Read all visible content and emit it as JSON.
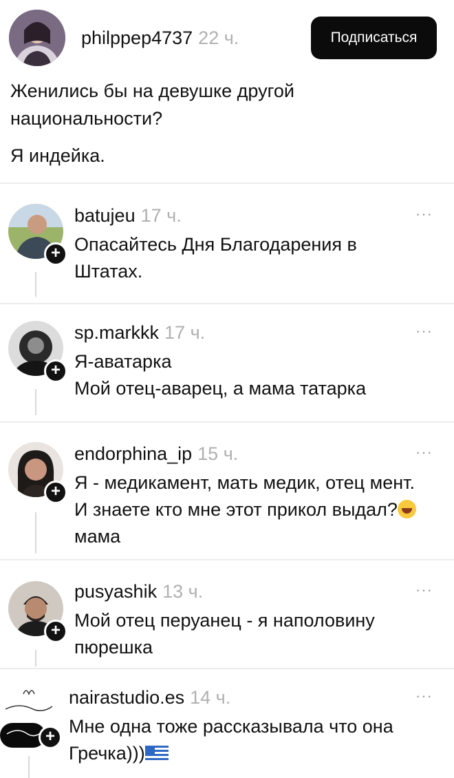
{
  "post": {
    "username": "philppep4737",
    "time": "22 ч.",
    "follow_label": "Подписаться",
    "text_lines": [
      "Женились бы на девушке другой",
      "национальности?"
    ],
    "text_line3": "Я индейка."
  },
  "comments": [
    {
      "username": "batujeu",
      "time": "17 ч.",
      "lines": [
        "Опасайтесь Дня Благодарения в",
        "Штатах."
      ]
    },
    {
      "username": "sp.markkk",
      "time": "17 ч.",
      "lines": [
        "Я-аватарка",
        "Мой отец-аварец, а мама татарка"
      ]
    },
    {
      "username": "endorphina_ip",
      "time": "15 ч.",
      "lines": [
        "Я - медикамент, мать медик, отец мент.",
        "И знаете кто мне этот прикол выдал?",
        "мама"
      ]
    },
    {
      "username": "pusyashik",
      "time": "13 ч.",
      "lines": [
        "Мой отец перуанец - я наполовину",
        "пюрешка"
      ]
    },
    {
      "username": "nairastudio.es",
      "time": "14 ч.",
      "lines": [
        "Мне одна тоже рассказывала что она",
        "Гречка)))"
      ]
    }
  ],
  "icons": {
    "more": "more-dots-icon",
    "follow": "plus-icon",
    "emoji": "grinning-squint-emoji",
    "flag": "greece-flag-emoji"
  },
  "more_label": "···",
  "plus_label": "+"
}
